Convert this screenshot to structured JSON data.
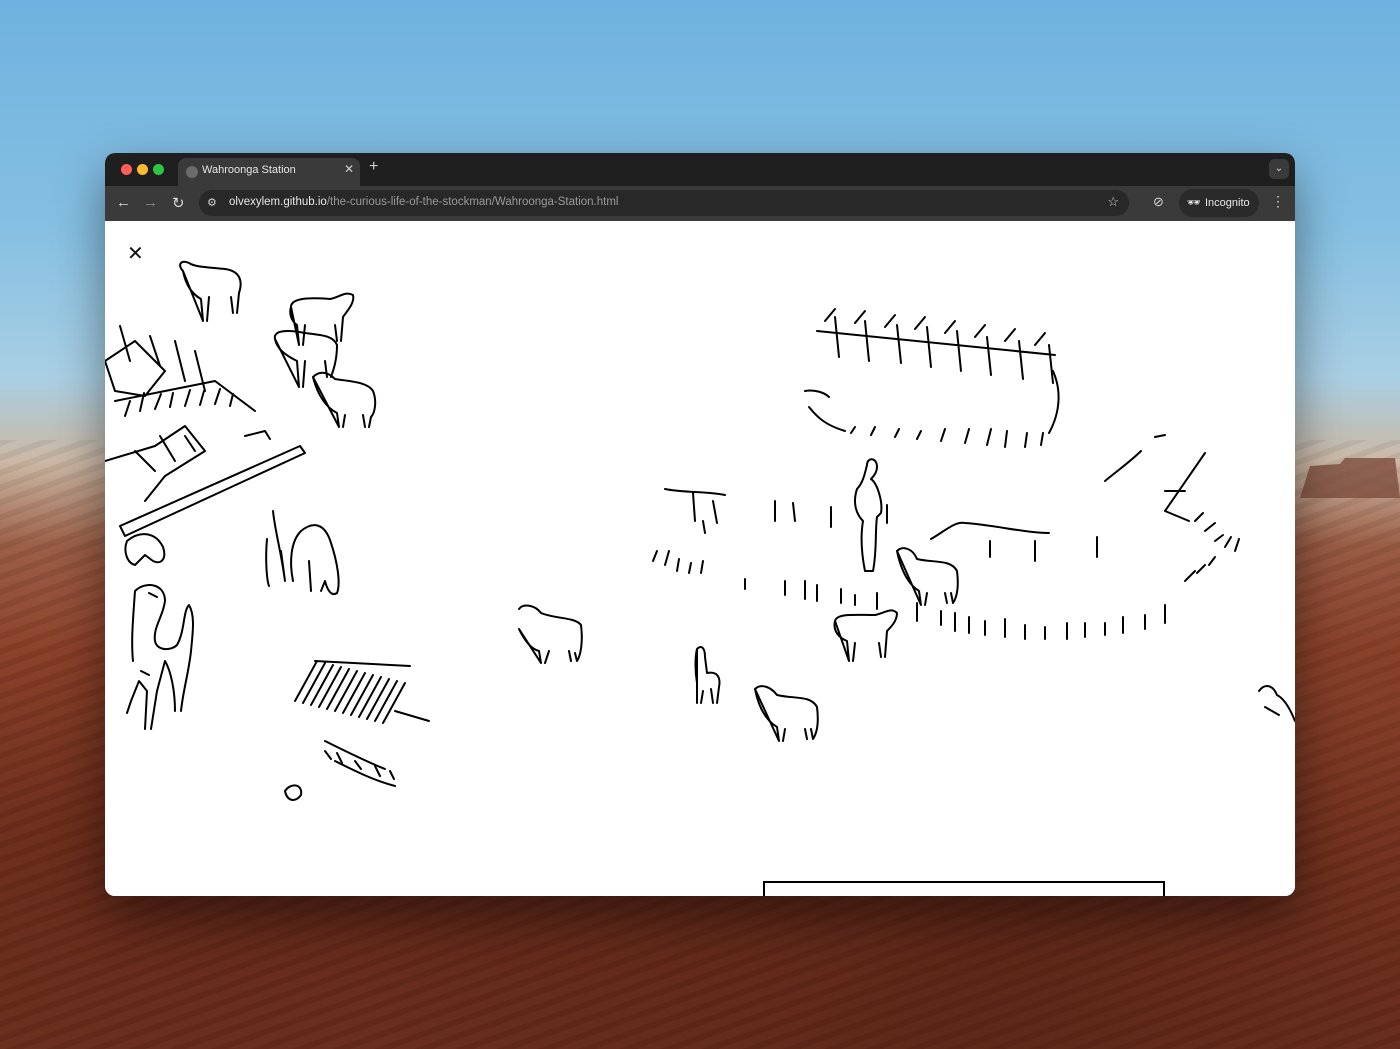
{
  "browser": {
    "tab_title": "Wahroonga Station",
    "new_tab_label": "+",
    "url_host": "olvexylem.github.io",
    "url_path": "/the-curious-life-of-the-stockman/Wahroonga-Station.html",
    "incognito_label": "Incognito"
  },
  "page": {
    "close_label": "✕"
  },
  "icons": {
    "back": "arrow-left-icon",
    "forward": "arrow-right-icon",
    "reload": "reload-icon",
    "site_info": "tune-icon",
    "bookmark": "star-icon",
    "extension": "extension-icon",
    "incognito": "incognito-icon",
    "menu": "kebab-menu-icon",
    "tab_search": "chevron-down-icon",
    "close": "close-icon"
  }
}
